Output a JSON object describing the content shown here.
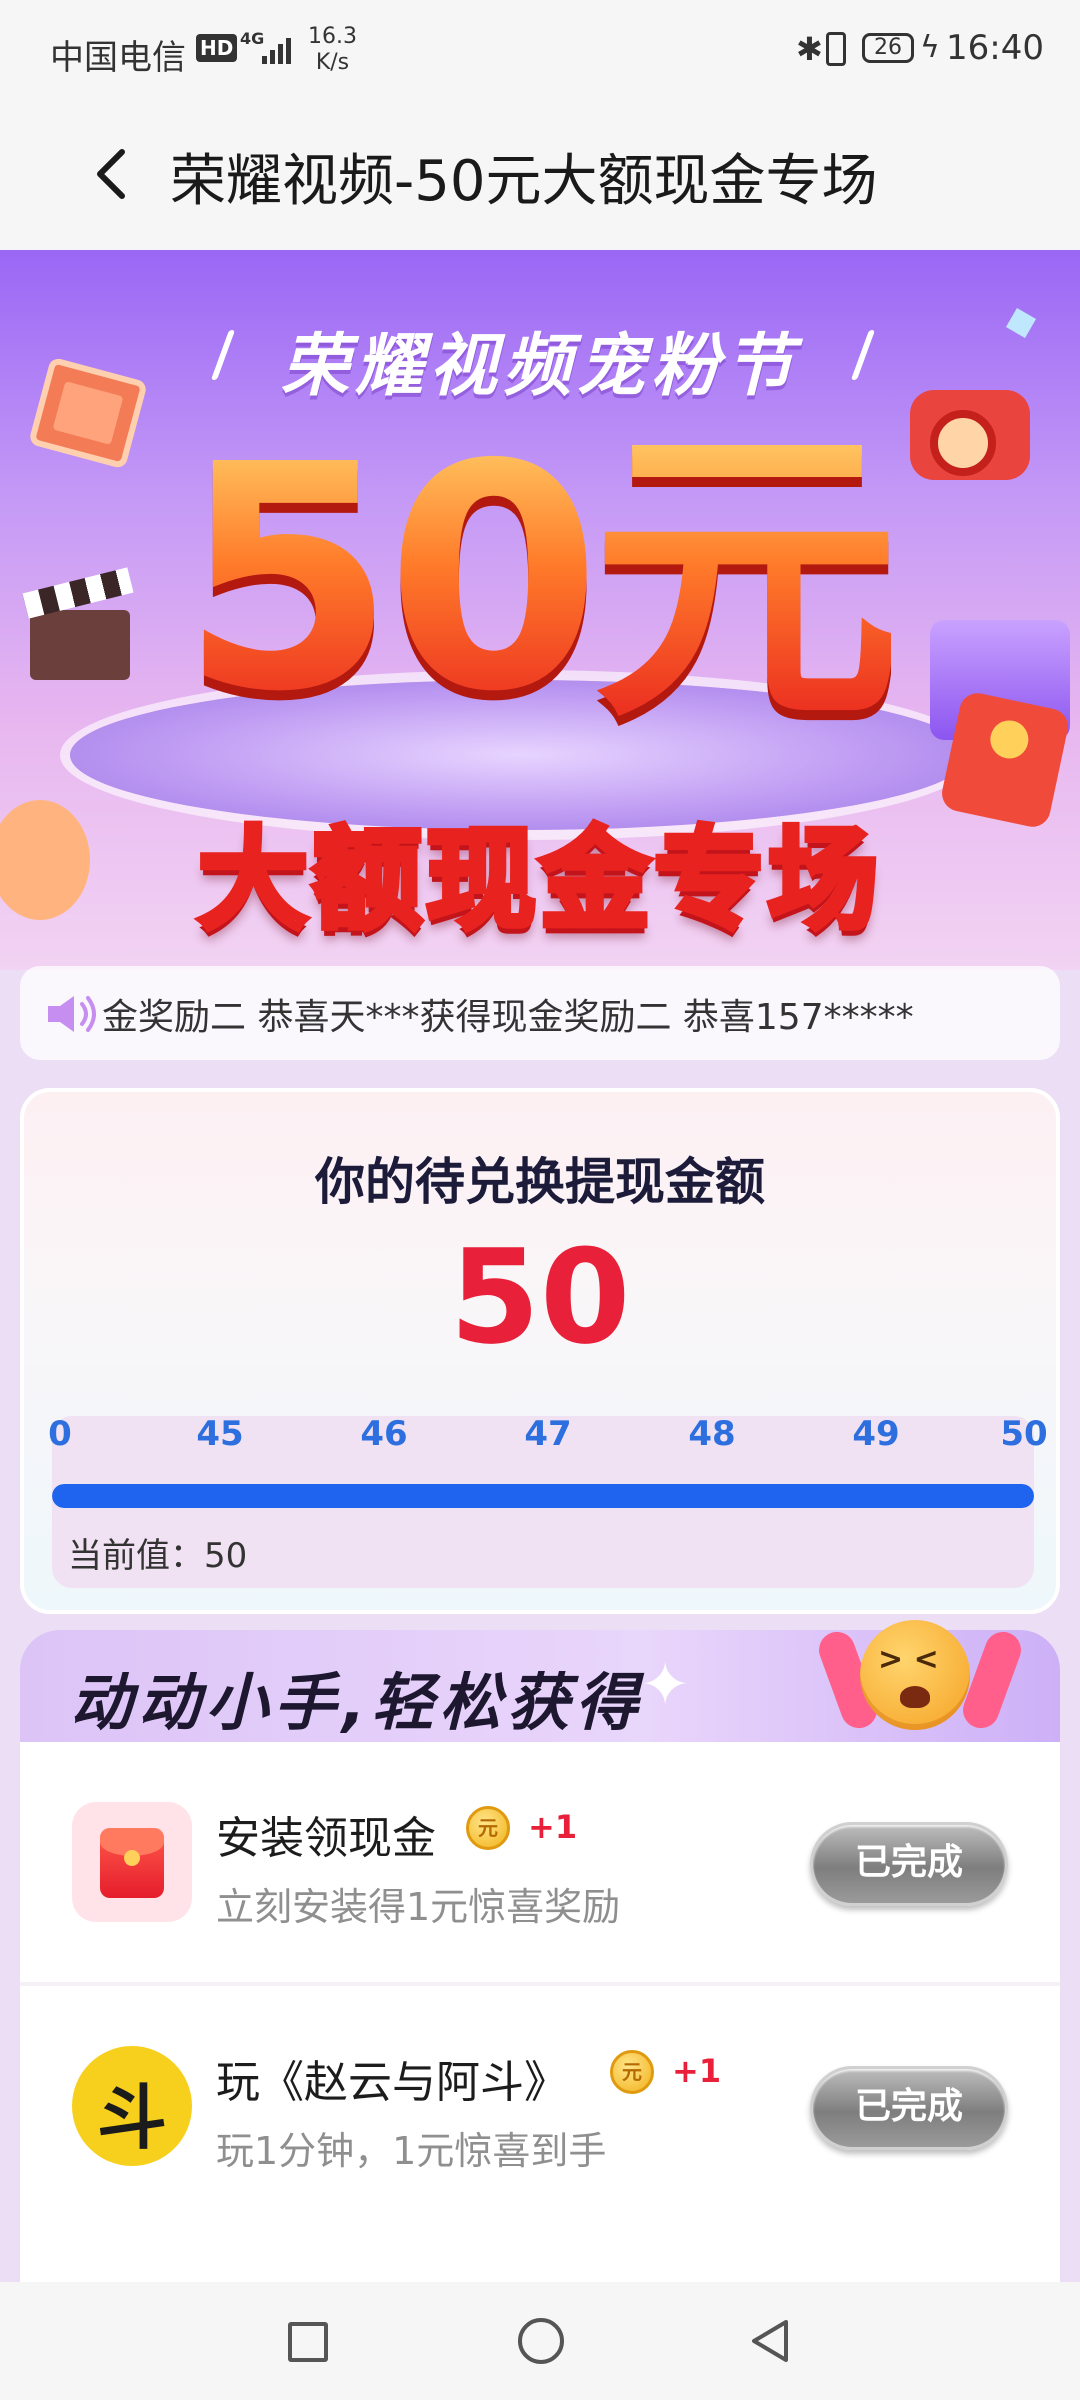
{
  "status_bar": {
    "carrier": "中国电信",
    "hd": "HD",
    "network": "4G",
    "speed_value": "16.3",
    "speed_unit": "K/s",
    "battery": "26",
    "time": "16:40"
  },
  "header": {
    "title": "荣耀视频-50元大额现金专场"
  },
  "banner": {
    "festival": "荣耀视频宠粉节",
    "amount": "50元",
    "subtitle": "大额现金专场"
  },
  "marquee": {
    "text": "金奖励二  恭喜天***获得现金奖励二  恭喜157*****"
  },
  "amount_card": {
    "label": "你的待兑换提现金额",
    "value": "50",
    "ticks": [
      "0",
      "45",
      "46",
      "47",
      "48",
      "49",
      "50"
    ],
    "progress_fraction": 1.0,
    "current_value": "当前值：50"
  },
  "tasks": {
    "title": "动动小手,轻松获得",
    "items": [
      {
        "name": "安装领现金",
        "coin": "元",
        "reward": "+1",
        "desc": "立刻安装得1元惊喜奖励",
        "button": "已完成"
      },
      {
        "name": "玩《赵云与阿斗》",
        "coin": "元",
        "reward": "+1",
        "desc": "玩1分钟，1元惊喜到手",
        "button": "已完成"
      }
    ]
  },
  "colors": {
    "accent_red": "#e8203a",
    "progress_blue": "#1f64ee",
    "tick_blue": "#2e6fe0"
  }
}
